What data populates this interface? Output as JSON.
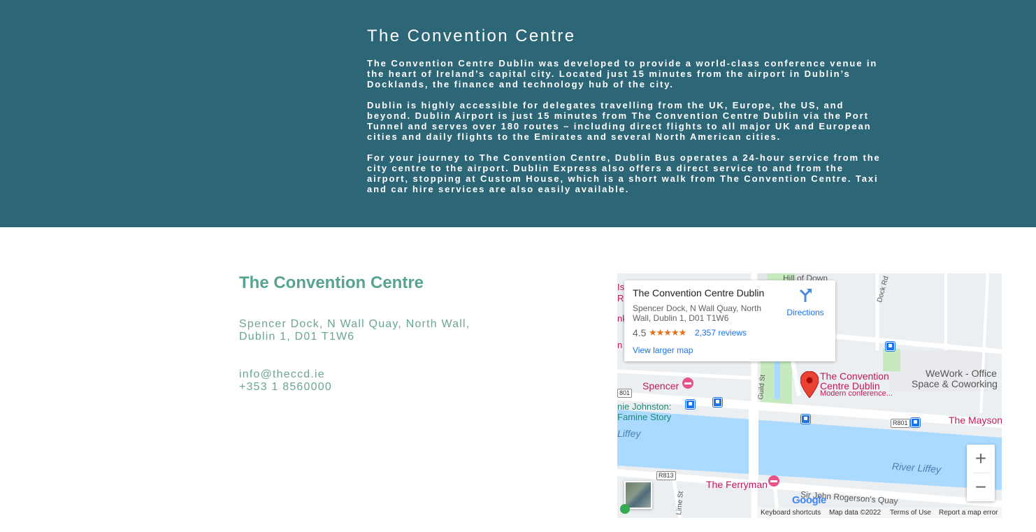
{
  "banner": {
    "title": "The Convention Centre",
    "paragraphs": [
      "The Convention Centre Dublin was developed to provide a world-class conference venue in the heart of Ireland’s capital city. Located just 15 minutes from the airport in Dublin’s Docklands, the finance and technology hub of the city.",
      "Dublin is highly accessible for delegates travelling from the UK, Europe, the US, and beyond. Dublin Airport is just 15 minutes from The Convention Centre Dublin via the Port Tunnel and serves over 180 routes – including direct flights to all major UK and European cities and daily flights to the Emirates and several North American cities.",
      "For your journey to The Convention Centre, Dublin Bus operates a 24-hour service from the city centre to the airport. Dublin Express also offers a direct service to and from the airport, stopping at Custom House, which is a short walk from The Convention Centre. Taxi and car hire services are also easily available."
    ]
  },
  "contact": {
    "title": "The Convention Centre",
    "address_line1": "Spencer Dock, N Wall Quay, North Wall,",
    "address_line2": "Dublin 1, D01 T1W6",
    "email": "info@theccd.ie",
    "phone": "+353 1 8560000"
  },
  "map": {
    "card": {
      "name": "The Convention Centre Dublin",
      "address": "Spencer Dock, N Wall Quay, North Wall, Dublin 1, D01 T1W6",
      "rating": "4.5",
      "stars": "★★★★★",
      "reviews": "2,357 reviews",
      "directions": "Directions",
      "view_larger": "View larger map"
    },
    "labels": {
      "pin_title_1": "The Convention",
      "pin_title_2": "Centre Dublin",
      "pin_sub": "Modern conference...",
      "wework_1": "WeWork - Office",
      "wework_2": "Space & Coworking",
      "spencer": "Spencer",
      "johnston_1": "nie Johnston:",
      "johnston_2": "Famine Story",
      "liffey_left": "Liffey",
      "river_liffey": "River Liffey",
      "mayson": "The Mayson",
      "ferryman": "The Ferryman",
      "rogerson": "Sir John Rogerson's Quay",
      "guild_st": "Guild St",
      "dock_rd": "Dock Rd",
      "lime_st": "Lime St",
      "hill": "Hill of Down",
      "r801": "R801",
      "r813": "R813",
      "r801_left": "801",
      "left_is": "Is",
      "left_r": "R",
      "left_nk": "nk",
      "left_n": "n"
    },
    "controls": {
      "zoom_in": "+",
      "zoom_out": "−"
    },
    "google": "Google",
    "footer": {
      "shortcuts": "Keyboard shortcuts",
      "mapdata": "Map data ©2022",
      "terms": "Terms of Use",
      "report": "Report a map error"
    },
    "colors": {
      "water": "#aadaff",
      "park": "#c7e9c0",
      "road": "#ffffff",
      "pin": "#ea4335"
    }
  }
}
